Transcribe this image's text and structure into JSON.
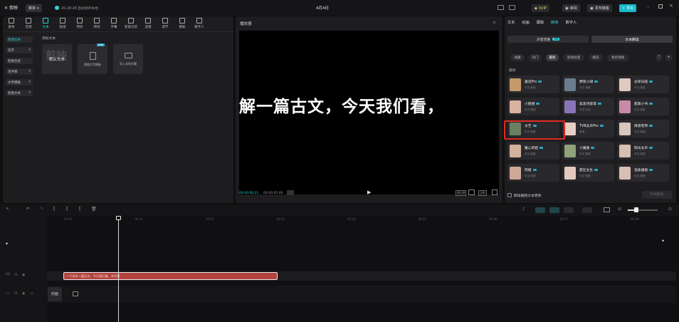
{
  "app": {
    "logo_label": "剪映",
    "menu_label": "菜单",
    "autosave_text": "20:28:28 自动保存本地",
    "project_title": "4月4日"
  },
  "titlebar_buttons": {
    "svip": "SVIP",
    "review": "审阅",
    "publish_template": "发布模版",
    "export": "导出"
  },
  "toolbar": {
    "items": [
      "素材",
      "音频",
      "文本",
      "贴纸",
      "特效",
      "转场",
      "字幕",
      "智能包装",
      "滤镜",
      "调节",
      "模板",
      "数字人"
    ],
    "active_index": 2
  },
  "left_panel": {
    "categories": [
      "新建文本",
      "花字",
      "智能包装",
      "花字库",
      "文字模板",
      "智能文本"
    ],
    "section_title": "添加文本",
    "cards": [
      {
        "label": "默认文本",
        "watermark": "剪映"
      },
      {
        "label": "智能文字模板",
        "badge": "new"
      },
      {
        "label": "导入本地字幕"
      }
    ]
  },
  "player": {
    "title": "播放器",
    "subtitle_text": "解一篇古文，今天我们看，",
    "current_time": "00:00:00:21",
    "total_time": "00:00:05:00",
    "buttons": [
      "原比例",
      "适应",
      "比例"
    ]
  },
  "right_panel": {
    "tabs": [
      "文本",
      "动画",
      "跟踪",
      "朗读",
      "数字人"
    ],
    "active_tab_index": 3,
    "subtabs": [
      "声音克隆",
      "文本朗读"
    ],
    "vip_badge": "VIP",
    "filters": [
      "收藏",
      "热门",
      "最新",
      "影视动漫",
      "解说",
      "角色演绎"
    ],
    "active_filter_index": 2,
    "section_label": "最新",
    "voices": [
      {
        "name": "童话Pro",
        "sub": "中文·英语",
        "color": "#c59a6b"
      },
      {
        "name": "野兽小胡",
        "sub": "中文·英语",
        "color": "#6a7d8c"
      },
      {
        "name": "古早白船",
        "sub": "中文·英语",
        "color": "#e0c9c0"
      },
      {
        "name": "小姐姐",
        "sub": "中文·英语",
        "color": "#d9b2a0"
      },
      {
        "name": "柔波诗意等",
        "sub": "中文·中文",
        "color": "#8a74b8"
      },
      {
        "name": "甜美小书",
        "sub": "中文·英语",
        "color": "#c98aa8"
      },
      {
        "name": "文艺",
        "sub": "中文·英语",
        "color": "#6b7f62"
      },
      {
        "name": "TVB女声Pro",
        "sub": "粤语",
        "color": "#e6cfc4"
      },
      {
        "name": "情感老师",
        "sub": "中文·英语",
        "color": "#d8c6bc"
      },
      {
        "name": "暖心阿姐",
        "sub": "中文·英语",
        "color": "#d2b29c"
      },
      {
        "name": "小魔童",
        "sub": "中文·英语",
        "color": "#8fa27a"
      },
      {
        "name": "阳光女声",
        "sub": "中文·英语",
        "color": "#d8bfb0"
      },
      {
        "name": "阿姐",
        "sub": "中文·英语",
        "color": "#cfa898"
      },
      {
        "name": "甜在女生",
        "sub": "中文·英语",
        "color": "#e4cabc"
      },
      {
        "name": "温柔播报",
        "sub": "中文·英语",
        "color": "#d9bfb2"
      }
    ],
    "highlighted_index": 6,
    "footer_checkbox": "朗读跟随文本更新",
    "footer_button": "开始朗读"
  },
  "timeline": {
    "ticks": [
      "00:00",
      "00:01",
      "00:02",
      "00:03",
      "00:04",
      "00:05",
      "00:06",
      "00:07",
      "00:08"
    ],
    "text_clip": "一千多年一篇古文，今天我们看，宋代就",
    "cover_label": "封面"
  },
  "colors": {
    "accent": "#2ed3d3",
    "highlight_border": "#e02a22",
    "clip": "#b3423c",
    "export_btn": "#19b8c9"
  }
}
